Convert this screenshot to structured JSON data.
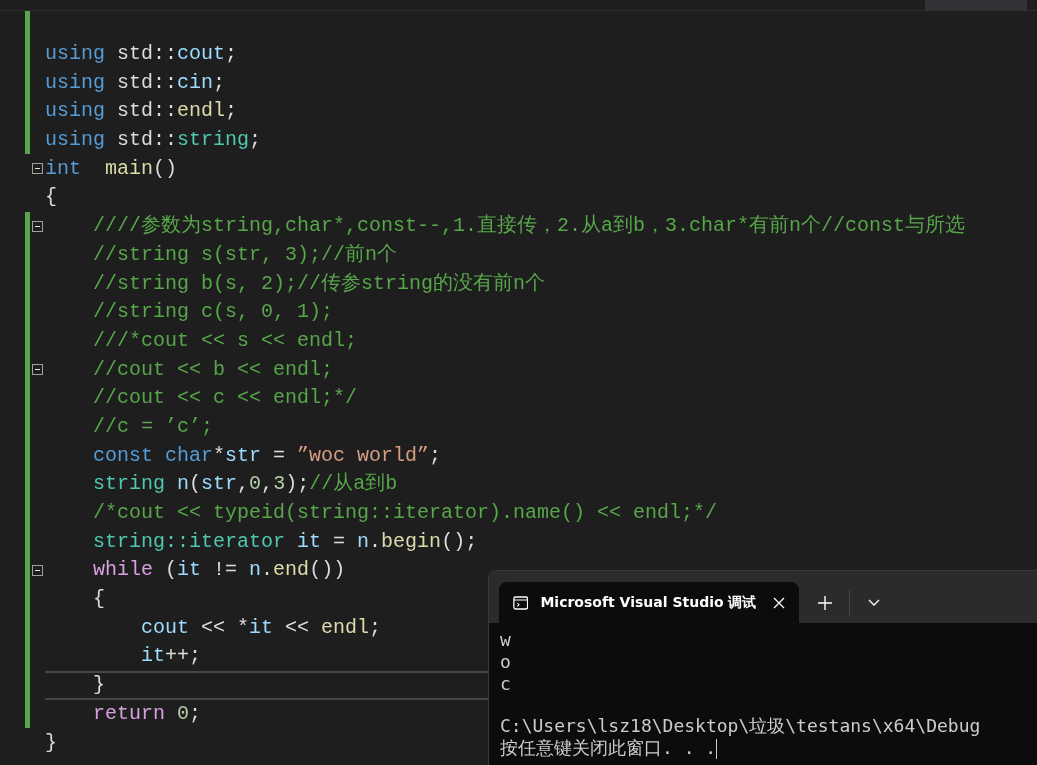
{
  "editor": {
    "lines": [
      {
        "changed": true,
        "fold": false,
        "current": false
      },
      {
        "changed": true,
        "fold": false,
        "current": false,
        "tokens": [
          {
            "kind": "keyword",
            "text": "using"
          },
          {
            "kind": "plain",
            "text": " std::"
          },
          {
            "kind": "variable",
            "text": "cout"
          },
          {
            "kind": "plain",
            "text": ";"
          }
        ]
      },
      {
        "changed": true,
        "fold": false,
        "current": false,
        "tokens": [
          {
            "kind": "keyword",
            "text": "using"
          },
          {
            "kind": "plain",
            "text": " std::"
          },
          {
            "kind": "variable",
            "text": "cin"
          },
          {
            "kind": "plain",
            "text": ";"
          }
        ]
      },
      {
        "changed": true,
        "fold": false,
        "current": false,
        "tokens": [
          {
            "kind": "keyword",
            "text": "using"
          },
          {
            "kind": "plain",
            "text": " std::"
          },
          {
            "kind": "function",
            "text": "endl"
          },
          {
            "kind": "plain",
            "text": ";"
          }
        ]
      },
      {
        "changed": true,
        "fold": false,
        "current": false,
        "tokens": [
          {
            "kind": "keyword",
            "text": "using"
          },
          {
            "kind": "plain",
            "text": " std::"
          },
          {
            "kind": "type",
            "text": "string"
          },
          {
            "kind": "plain",
            "text": ";"
          }
        ]
      },
      {
        "changed": false,
        "fold": true,
        "current": false,
        "tokens": [
          {
            "kind": "keyword",
            "text": "int"
          },
          {
            "kind": "function",
            "text": "  main"
          },
          {
            "kind": "plain",
            "text": "()"
          }
        ]
      },
      {
        "changed": false,
        "fold": false,
        "current": false,
        "tokens": [
          {
            "kind": "plain",
            "text": "{"
          }
        ]
      },
      {
        "changed": true,
        "fold": true,
        "current": false,
        "tokens": [
          {
            "kind": "comment",
            "text": "    ////参数为string,char*,const--,1.直接传，2.从a到b，3.char*有前n个//const与所选"
          }
        ]
      },
      {
        "changed": true,
        "fold": false,
        "current": false,
        "tokens": [
          {
            "kind": "comment",
            "text": "    //string s(str, 3);//前n个"
          }
        ]
      },
      {
        "changed": true,
        "fold": false,
        "current": false,
        "tokens": [
          {
            "kind": "comment",
            "text": "    //string b(s, 2);//传参string的没有前n个"
          }
        ]
      },
      {
        "changed": true,
        "fold": false,
        "current": false,
        "tokens": [
          {
            "kind": "comment",
            "text": "    //string c(s, 0, 1);"
          }
        ]
      },
      {
        "changed": true,
        "fold": false,
        "current": false,
        "tokens": [
          {
            "kind": "comment",
            "text": "    ///*cout << s << endl;"
          }
        ]
      },
      {
        "changed": true,
        "fold": true,
        "current": false,
        "tokens": [
          {
            "kind": "comment",
            "text": "    //cout << b << endl;"
          }
        ]
      },
      {
        "changed": true,
        "fold": false,
        "current": false,
        "tokens": [
          {
            "kind": "comment",
            "text": "    //cout << c << endl;*/"
          }
        ]
      },
      {
        "changed": true,
        "fold": false,
        "current": false,
        "tokens": [
          {
            "kind": "comment",
            "text": "    //c = ’c’;"
          }
        ]
      },
      {
        "changed": true,
        "fold": false,
        "current": false,
        "tokens": [
          {
            "kind": "keyword",
            "text": "    const char"
          },
          {
            "kind": "plain",
            "text": "*"
          },
          {
            "kind": "variable",
            "text": "str"
          },
          {
            "kind": "plain",
            "text": " = "
          },
          {
            "kind": "string",
            "text": "”woc world”"
          },
          {
            "kind": "plain",
            "text": ";"
          }
        ]
      },
      {
        "changed": true,
        "fold": false,
        "current": false,
        "tokens": [
          {
            "kind": "type",
            "text": "    string"
          },
          {
            "kind": "variable",
            "text": " n"
          },
          {
            "kind": "plain",
            "text": "("
          },
          {
            "kind": "variable",
            "text": "str"
          },
          {
            "kind": "plain",
            "text": ","
          },
          {
            "kind": "number",
            "text": "0"
          },
          {
            "kind": "plain",
            "text": ","
          },
          {
            "kind": "number",
            "text": "3"
          },
          {
            "kind": "plain",
            "text": ");"
          },
          {
            "kind": "comment",
            "text": "//从a到b"
          }
        ]
      },
      {
        "changed": true,
        "fold": false,
        "current": false,
        "tokens": [
          {
            "kind": "comment",
            "text": "    /*cout << typeid(string::iterator).name() << endl;*/"
          }
        ]
      },
      {
        "changed": true,
        "fold": false,
        "current": false,
        "tokens": [
          {
            "kind": "type",
            "text": "    string::iterator"
          },
          {
            "kind": "variable",
            "text": " it"
          },
          {
            "kind": "plain",
            "text": " = "
          },
          {
            "kind": "variable",
            "text": "n"
          },
          {
            "kind": "plain",
            "text": "."
          },
          {
            "kind": "function",
            "text": "begin"
          },
          {
            "kind": "plain",
            "text": "();"
          }
        ]
      },
      {
        "changed": true,
        "fold": true,
        "current": false,
        "tokens": [
          {
            "kind": "control",
            "text": "    while"
          },
          {
            "kind": "plain",
            "text": " ("
          },
          {
            "kind": "variable",
            "text": "it"
          },
          {
            "kind": "plain",
            "text": " != "
          },
          {
            "kind": "variable",
            "text": "n"
          },
          {
            "kind": "plain",
            "text": "."
          },
          {
            "kind": "function",
            "text": "end"
          },
          {
            "kind": "plain",
            "text": "())"
          }
        ]
      },
      {
        "changed": true,
        "fold": false,
        "current": false,
        "tokens": [
          {
            "kind": "plain",
            "text": "    {"
          }
        ]
      },
      {
        "changed": true,
        "fold": false,
        "current": false,
        "tokens": [
          {
            "kind": "variable",
            "text": "        cout"
          },
          {
            "kind": "plain",
            "text": " << *"
          },
          {
            "kind": "variable",
            "text": "it"
          },
          {
            "kind": "plain",
            "text": " << "
          },
          {
            "kind": "function",
            "text": "endl"
          },
          {
            "kind": "plain",
            "text": ";"
          }
        ]
      },
      {
        "changed": true,
        "fold": false,
        "current": false,
        "tokens": [
          {
            "kind": "variable",
            "text": "        it"
          },
          {
            "kind": "plain",
            "text": "++;"
          }
        ]
      },
      {
        "changed": true,
        "fold": false,
        "current": true,
        "tokens": [
          {
            "kind": "plain",
            "text": "    }"
          }
        ]
      },
      {
        "changed": true,
        "fold": false,
        "current": false,
        "tokens": [
          {
            "kind": "control",
            "text": "    return"
          },
          {
            "kind": "number",
            "text": " 0"
          },
          {
            "kind": "plain",
            "text": ";"
          }
        ]
      },
      {
        "changed": false,
        "fold": false,
        "current": false,
        "tokens": [
          {
            "kind": "plain",
            "text": "}"
          }
        ]
      }
    ]
  },
  "terminal": {
    "tabs": [
      {
        "title": "Microsoft Visual Studio 调试",
        "selected": true
      }
    ],
    "results": [
      "w",
      "o",
      "c"
    ],
    "prompt": [
      "C:\\Users\\lsz18\\Desktop\\垃圾\\testans\\x64\\Debug",
      "按任意键关闭此窗口. . ."
    ]
  }
}
